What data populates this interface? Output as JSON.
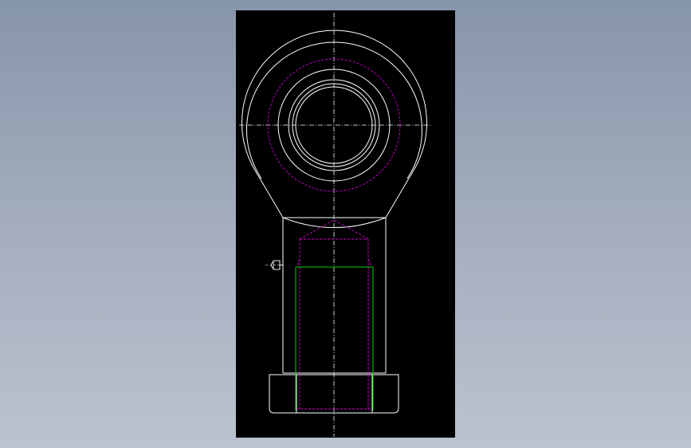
{
  "canvas": {
    "background": "#000000",
    "page_background": [
      "#8795aa",
      "#bcc3cf"
    ]
  },
  "colors": {
    "outline": "#ffffff",
    "hidden": "#d000d0",
    "thread": "#00d000",
    "centerline": "#ffffff"
  },
  "drawing": {
    "subject": "rod-end-bearing",
    "views": [
      "front-view"
    ],
    "linetypes": [
      "continuous",
      "dashed",
      "center"
    ]
  }
}
